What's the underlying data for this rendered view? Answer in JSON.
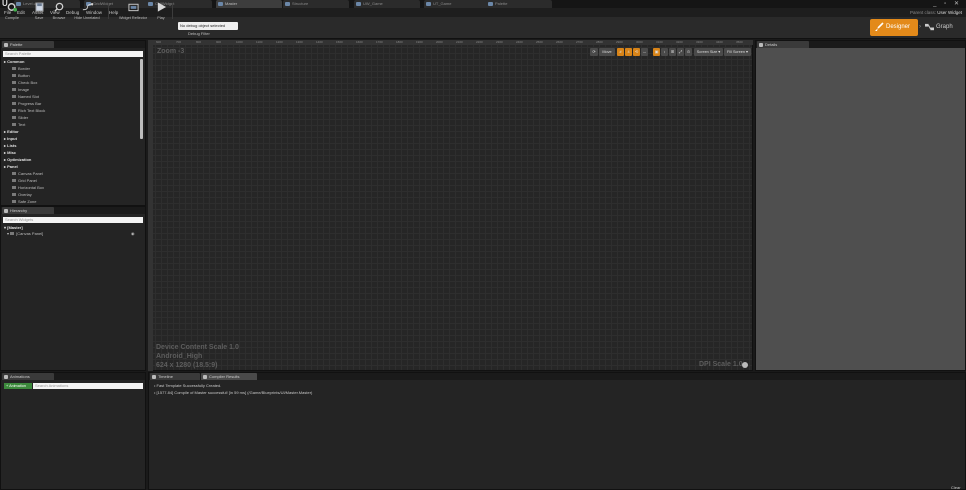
{
  "tabs": [
    {
      "label": "Level.umap",
      "active": false
    },
    {
      "label": "GridWidget",
      "active": false
    },
    {
      "label": "CellWidget",
      "active": false
    },
    {
      "label": "Master",
      "active": true
    },
    {
      "label": "Structure",
      "active": false
    },
    {
      "label": "UW_Game",
      "active": false
    },
    {
      "label": "UT_Game",
      "active": false
    },
    {
      "label": "Palette",
      "active": false
    }
  ],
  "menu": [
    "File",
    "Edit",
    "Asset",
    "View",
    "Debug",
    "Window",
    "Help"
  ],
  "parent_class": {
    "label": "Parent class:",
    "value": "User Widget"
  },
  "toolbar": {
    "compile": "Compile",
    "save": "Save",
    "browse": "Browse",
    "hide_unrelated": "Hide Unrelated",
    "widget_reflector": "Widget Reflector",
    "play": "Play",
    "debug_select": "No debug object selected",
    "debug_filter": "Debug Filter"
  },
  "mode": {
    "designer": "Designer",
    "graph": "Graph"
  },
  "palette": {
    "tab": "Palette",
    "search_placeholder": "Search Palette",
    "rows": [
      {
        "label": "Common",
        "type": "cat"
      },
      {
        "label": "Border",
        "type": "item"
      },
      {
        "label": "Button",
        "type": "item"
      },
      {
        "label": "Check Box",
        "type": "item"
      },
      {
        "label": "Image",
        "type": "item"
      },
      {
        "label": "Named Slot",
        "type": "item"
      },
      {
        "label": "Progress Bar",
        "type": "item"
      },
      {
        "label": "Rich Text Block",
        "type": "item"
      },
      {
        "label": "Slider",
        "type": "item"
      },
      {
        "label": "Text",
        "type": "item"
      },
      {
        "label": "Editor",
        "type": "cat"
      },
      {
        "label": "Input",
        "type": "cat"
      },
      {
        "label": "Lists",
        "type": "cat"
      },
      {
        "label": "Misc",
        "type": "cat"
      },
      {
        "label": "Optimization",
        "type": "cat"
      },
      {
        "label": "Panel",
        "type": "cat"
      },
      {
        "label": "Canvas Panel",
        "type": "item"
      },
      {
        "label": "Grid Panel",
        "type": "item"
      },
      {
        "label": "Horizontal Box",
        "type": "item"
      },
      {
        "label": "Overlay",
        "type": "item"
      },
      {
        "label": "Safe Zone",
        "type": "item"
      }
    ]
  },
  "hierarchy": {
    "tab": "Hierarchy",
    "search_placeholder": "Search Widgets",
    "root": "[Master]",
    "child": "[Canvas Panel]"
  },
  "canvas": {
    "zoom": "Zoom -3",
    "move": "Move",
    "screen_size": "Screen Size",
    "fill_screen": "Fill Screen",
    "scale": "Device Content Scale 1.0",
    "profile": "Android_High",
    "resolution": "624 x 1280 (18.5:9)",
    "dpi": "DPI Scale 1.0",
    "ruler": [
      "600",
      "700",
      "800",
      "900",
      "1000",
      "1100",
      "1200",
      "1300",
      "1400",
      "1500",
      "1600",
      "1700",
      "1800",
      "1900",
      "2000",
      "2100",
      "2200",
      "2300",
      "2400",
      "2500",
      "2600",
      "2700",
      "2800",
      "2900",
      "3000",
      "3100",
      "3200",
      "3300",
      "3400",
      "3500"
    ]
  },
  "details": {
    "tab": "Details"
  },
  "animations": {
    "tab": "Animations",
    "add": "+ Animation",
    "search_placeholder": "Search Animations"
  },
  "timeline": {
    "tabs": [
      "Timeline",
      "Compiler Results"
    ],
    "log": [
      "Fast Template Successfully Created.",
      "[1577.84] Compile of Master successful! [in 59 ms] (/Game/Blueprints/UI/Master.Master)"
    ],
    "clear": "Clear"
  },
  "colors": {
    "accent": "#e38a1a",
    "arrow": "#3aa0e8",
    "anim_green": "#3c8a3c"
  }
}
